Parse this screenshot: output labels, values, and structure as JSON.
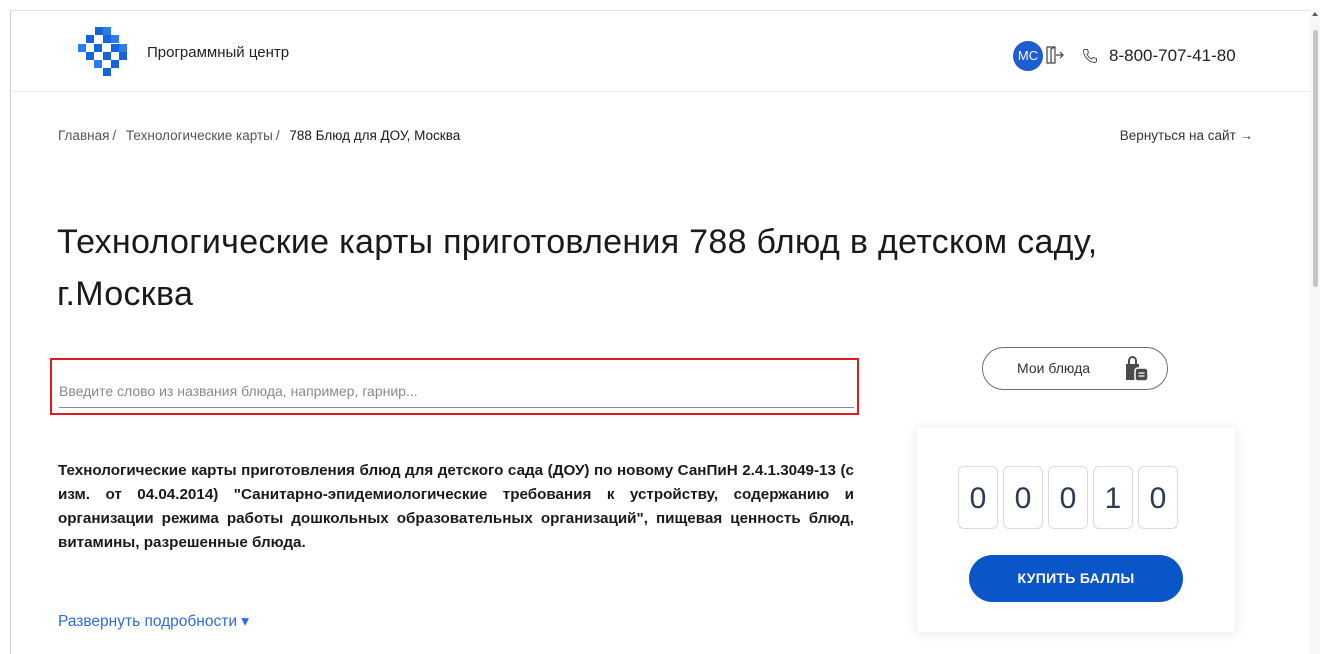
{
  "header": {
    "logo_text": "Программный центр",
    "user_initials": "МС",
    "phone": "8-800-707-41-80"
  },
  "breadcrumb": {
    "items": [
      "Главная",
      "Технологические карты",
      "788 Блюд для ДОУ, Москва"
    ],
    "separator": "/"
  },
  "back_link": "Вернуться на сайт →",
  "page_title": "Технологические карты приготовления 788 блюд в детском саду, г.Москва",
  "search": {
    "placeholder": "Введите слово из названия блюда, например, гарнир...",
    "value": ""
  },
  "description": "Технологические карты приготовления блюд для детского сада (ДОУ) по новому СанПиН 2.4.1.3049-13 (с изм. от 04.04.2014) \"Санитарно-эпидемиологические требования к устройству, содержанию и организации режима работы дошкольных образовательных организаций\", пищевая ценность блюд, витамины, разрешенные блюда.",
  "expand_link": "Развернуть подробности ▾",
  "my_dishes_label": "Мои блюда",
  "points": {
    "digits": [
      "0",
      "0",
      "0",
      "1",
      "0"
    ],
    "buy_label": "КУПИТЬ БАЛЛЫ"
  },
  "colors": {
    "accent_blue": "#0a56c8",
    "avatar_blue": "#1e5cd3",
    "link_blue": "#2b6de0",
    "highlight_red": "#e01b1b"
  },
  "icons": {
    "logo": "logo-icon",
    "logout": "logout-icon",
    "phone": "phone-icon",
    "bag": "shopping-bag-icon"
  }
}
